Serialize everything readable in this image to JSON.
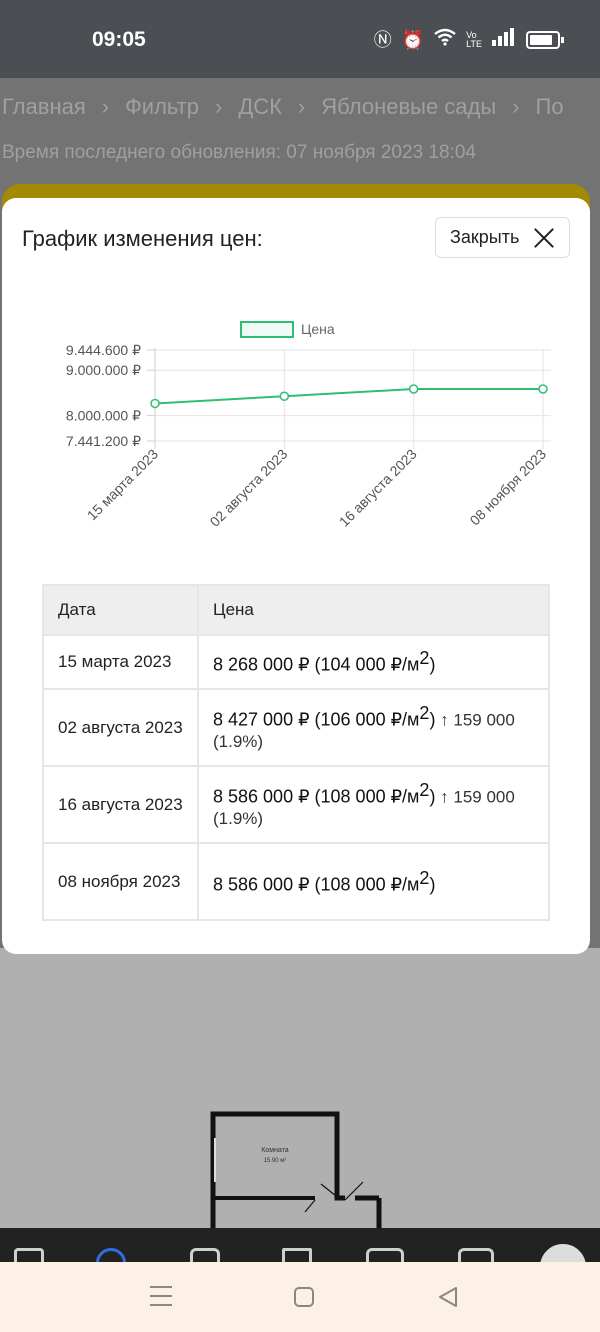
{
  "status_bar": {
    "time": "09:05"
  },
  "breadcrumb": [
    "Главная",
    "Фильтр",
    "ДСК",
    "Яблоневые сады",
    "По"
  ],
  "updated_text": "Время последнего обновления: 07 ноября 2023 18:04",
  "modal": {
    "title": "График изменения цен:",
    "close_label": "Закрыть"
  },
  "chart_data": {
    "type": "line",
    "legend": "Цена",
    "x": [
      "15 марта 2023",
      "02 августа 2023",
      "16 августа 2023",
      "08 ноября 2023"
    ],
    "values": [
      8268000,
      8427000,
      8586000,
      8586000
    ],
    "ylim": [
      7441200,
      9444600
    ],
    "yticks": [
      {
        "value": 9444600,
        "label": "9.444.600 ₽"
      },
      {
        "value": 9000000,
        "label": "9.000.000 ₽"
      },
      {
        "value": 8000000,
        "label": "8.000.000 ₽"
      },
      {
        "value": 7441200,
        "label": "7.441.200 ₽"
      }
    ],
    "color": "#2fbf71",
    "grid": true,
    "legend_position": "top-center"
  },
  "table": {
    "headers": [
      "Дата",
      "Цена"
    ],
    "rows": [
      {
        "date": "15 марта 2023",
        "price": "8 268 000 ₽ (104 000 ₽/м",
        "sup": "2",
        "price_end": ")",
        "change": ""
      },
      {
        "date": "02 августа 2023",
        "price": "8 427 000 ₽ (106 000 ₽/м",
        "sup": "2",
        "price_end": ")",
        "change": " ↑ 159 000 (1.9%)"
      },
      {
        "date": "16 августа 2023",
        "price": "8 586 000 ₽ (108 000 ₽/м",
        "sup": "2",
        "price_end": ")",
        "change": " ↑ 159 000 (1.9%)"
      },
      {
        "date": "08 ноября 2023",
        "price": "8 586 000 ₽ (108 000 ₽/м",
        "sup": "2",
        "price_end": ")",
        "change": ""
      }
    ]
  },
  "plan": {
    "room_label": "Комната",
    "room_area": "15.90 м²"
  }
}
